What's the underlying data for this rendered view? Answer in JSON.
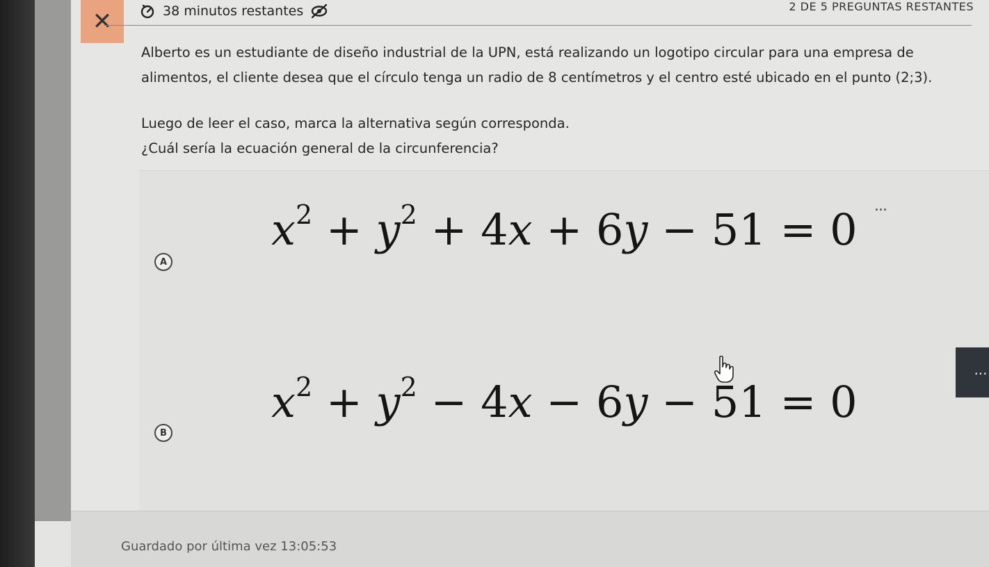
{
  "header": {
    "close_label": "✕",
    "timer_text": "38 minutos restantes",
    "progress_text": "2 DE 5 PREGUNTAS RESTANTES"
  },
  "question": {
    "case_text": "Alberto es un estudiante de diseño industrial de la UPN, está realizando un logotipo circular para una empresa de alimentos, el cliente desea que el círculo tenga un radio de 8 centímetros y el centro esté ubicado en el punto (2;3).",
    "instruction": "Luego de leer el caso, marca la alternativa según corresponda.",
    "prompt": "¿Cuál sería la ecuación general de la circunferencia?"
  },
  "options": [
    {
      "letter": "A",
      "x_var": "x",
      "x_exp": "2",
      "op1": "+",
      "y_var": "y",
      "y_exp": "2",
      "op2": "+",
      "term3_coef": "4",
      "term3_var": "x",
      "op3": "+",
      "term4_coef": "6",
      "term4_var": "y",
      "op4": "−",
      "const": "51",
      "eq": "=",
      "rhs": "0",
      "menu": "..."
    },
    {
      "letter": "B",
      "x_var": "x",
      "x_exp": "2",
      "op1": "+",
      "y_var": "y",
      "y_exp": "2",
      "op2": "−",
      "term3_coef": "4",
      "term3_var": "x",
      "op3": "−",
      "term4_coef": "6",
      "term4_var": "y",
      "op4": "−",
      "const": "51",
      "eq": "=",
      "rhs": "0",
      "menu": "..."
    }
  ],
  "footer": {
    "saved_text": "Guardado por última vez 13:05:53"
  },
  "icons": {
    "timer": "timer-icon",
    "hide": "eye-slash-icon",
    "cursor": "hand-pointer-icon"
  },
  "colors": {
    "close_bg": "#e9a37e",
    "menu_active_bg": "#2f353a"
  }
}
